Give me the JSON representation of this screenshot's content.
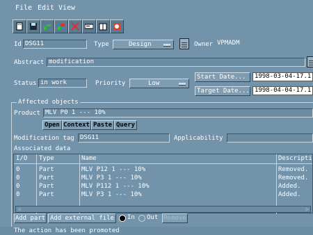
{
  "menu": {
    "file": "File",
    "edit": "Edit",
    "view": "View"
  },
  "toolbar": {
    "icons": [
      "new-document-icon",
      "save-icon",
      "promote-icon",
      "demote-icon",
      "delete-icon",
      "list-icon",
      "book-icon",
      "history-icon"
    ]
  },
  "form": {
    "id_label": "Id",
    "id_value": "DSG11",
    "type_label": "Type",
    "type_value": "Design",
    "owner_label": "Owner",
    "owner_value": "VPMADM",
    "abstract_label": "Abstract",
    "abstract_value": "modification",
    "status_label": "Status",
    "status_value": "in work",
    "priority_label": "Priority",
    "priority_value": "Low",
    "start_date_button": "Start Date...",
    "start_date_value": "1998-03-04-17.1",
    "target_date_button": "Target Date...",
    "target_date_value": "1998-04-04-17.1"
  },
  "affected": {
    "section_title": "Affected objects",
    "product_label": "Product",
    "product_value": "MLV P0 1 --- 10%",
    "buttons": {
      "open": "Open",
      "context": "Context",
      "paste": "Paste",
      "query": "Query"
    },
    "modification_tag_label": "Modification tag",
    "modification_tag_value": "DSG11",
    "applicability_label": "Applicability",
    "associated_label": "Associated data",
    "columns": [
      "I/O",
      "Type",
      "Name",
      "Descripti"
    ],
    "rows": [
      {
        "io": "0",
        "type": "Part",
        "name": "MLV P12 1 --- 10%",
        "desc": "Removed."
      },
      {
        "io": "0",
        "type": "Part",
        "name": "MLV P3 1 --- 10%",
        "desc": "Removed."
      },
      {
        "io": "0",
        "type": "Part",
        "name": "MLV P112 1 --- 10%",
        "desc": "Added."
      },
      {
        "io": "0",
        "type": "Part",
        "name": "MLV P3 1 --- 10%",
        "desc": "Added."
      }
    ]
  },
  "bottom": {
    "add_part": "Add part",
    "add_external_file": "Add external file",
    "radio_in": "In",
    "radio_out": "Out",
    "remove": "Remove",
    "status_message": "The action has been promoted"
  }
}
